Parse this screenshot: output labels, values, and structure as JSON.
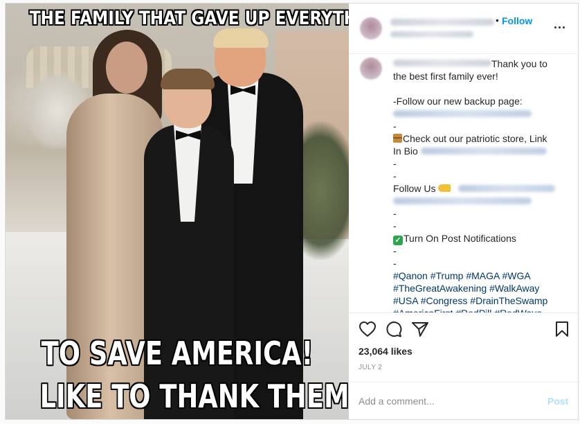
{
  "image": {
    "top_text": "THE FAMILY THAT GAVE UP EVERYTHING",
    "bottom_line1": "TO SAVE AMERICA!",
    "bottom_line2": "LIKE TO THANK THEM!"
  },
  "header": {
    "separator": "•",
    "follow_label": "Follow",
    "more_label": "..."
  },
  "caption": {
    "line1": "Thank you to",
    "line2": "the best first family ever!",
    "follow_backup": "-Follow our new backup page:",
    "dash": "-",
    "store_line1": "Check out our patriotic store, Link",
    "store_line2": "In Bio",
    "follow_us": "Follow Us",
    "notifications": "Turn On Post Notifications",
    "hashtags_line1": [
      "#Qanon",
      "#Trump",
      "#MAGA",
      "#WGA"
    ],
    "hashtags_line2": [
      "#TheGreatAwakening",
      "#WalkAway"
    ],
    "hashtags_line3": [
      "#USA",
      "#Congress",
      "#DrainTheSwamp"
    ],
    "hashtags_line4": [
      "#AmericaFirst",
      "#RedPill",
      "#RedWave"
    ]
  },
  "icons": {
    "like": "heart-icon",
    "comment": "comment-icon",
    "share": "share-icon",
    "save": "bookmark-icon"
  },
  "stats": {
    "likes": "23,064 likes",
    "date": "JULY 2"
  },
  "comment": {
    "placeholder": "Add a comment...",
    "post_label": "Post"
  },
  "colors": {
    "link_blue": "#0095f6",
    "hashtag": "#00376b",
    "post_disabled": "#b2dffc"
  }
}
